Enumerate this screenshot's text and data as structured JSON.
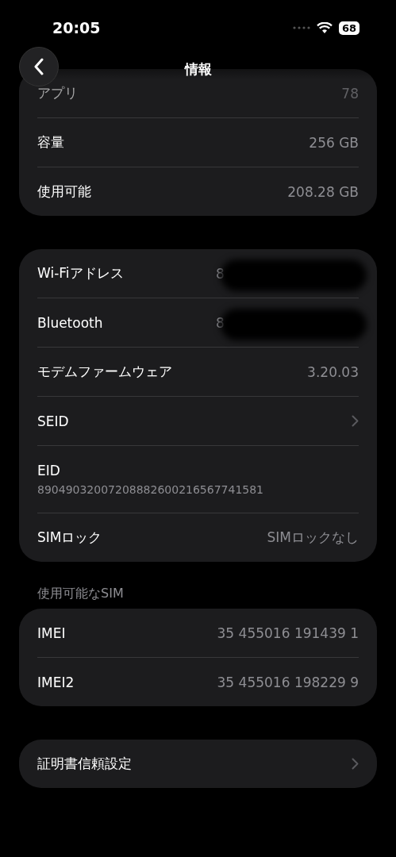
{
  "status_bar": {
    "time": "20:05",
    "battery": "68"
  },
  "nav": {
    "title": "情報"
  },
  "groups": [
    {
      "rows": [
        {
          "kind": "value",
          "label": "アプリ",
          "value": "78",
          "faded": true
        },
        {
          "kind": "value",
          "label": "容量",
          "value": "256 GB",
          "faded": false
        },
        {
          "kind": "value",
          "label": "使用可能",
          "value": "208.28 GB",
          "faded": false
        }
      ]
    },
    {
      "rows": [
        {
          "kind": "redacted",
          "label": "Wi-Fiアドレス",
          "value": "8"
        },
        {
          "kind": "redacted",
          "label": "Bluetooth",
          "value": "8"
        },
        {
          "kind": "value",
          "label": "モデムファームウェア",
          "value": "3.20.03",
          "faded": false
        },
        {
          "kind": "link",
          "label": "SEID"
        },
        {
          "kind": "stacked",
          "label": "EID",
          "value": "89049032007208882600216567741581"
        },
        {
          "kind": "value",
          "label": "SIMロック",
          "value": "SIMロックなし",
          "faded": false
        }
      ]
    },
    {
      "header": "使用可能なSIM",
      "rows": [
        {
          "kind": "value",
          "label": "IMEI",
          "value": "35 455016 191439 1",
          "faded": false
        },
        {
          "kind": "value",
          "label": "IMEI2",
          "value": "35 455016 198229 9",
          "faded": false
        }
      ]
    },
    {
      "rows": [
        {
          "kind": "link",
          "label": "証明書信頼設定"
        }
      ]
    }
  ]
}
